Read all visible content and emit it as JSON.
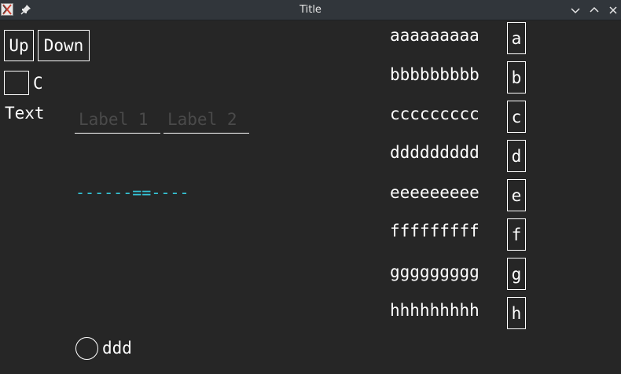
{
  "window": {
    "title": "Title"
  },
  "buttons": {
    "up_label": "Up",
    "down_label": "Down"
  },
  "checkbox": {
    "label": "C"
  },
  "text_label": "Text",
  "inputs": {
    "field1_placeholder": "Label 1",
    "field2_placeholder": "Label 2"
  },
  "slider": {
    "left_dashes": "------",
    "handle": "==",
    "right_dashes": "----"
  },
  "radio": {
    "label": "ddd"
  },
  "rows": [
    {
      "label": "aaaaaaaaa",
      "button": "a"
    },
    {
      "label": "bbbbbbbbb",
      "button": "b"
    },
    {
      "label": "ccccccccc",
      "button": "c"
    },
    {
      "label": "ddddddddd",
      "button": "d"
    },
    {
      "label": "eeeeeeeee",
      "button": "e"
    },
    {
      "label": "fffffffff",
      "button": "f"
    },
    {
      "label": "ggggggggg",
      "button": "g"
    },
    {
      "label": "hhhhhhhhh",
      "button": "h"
    }
  ],
  "colors": {
    "background": "#262626",
    "titlebar": "#31363b",
    "slider_accent": "#35c5d8",
    "placeholder": "#4a4a4a"
  }
}
